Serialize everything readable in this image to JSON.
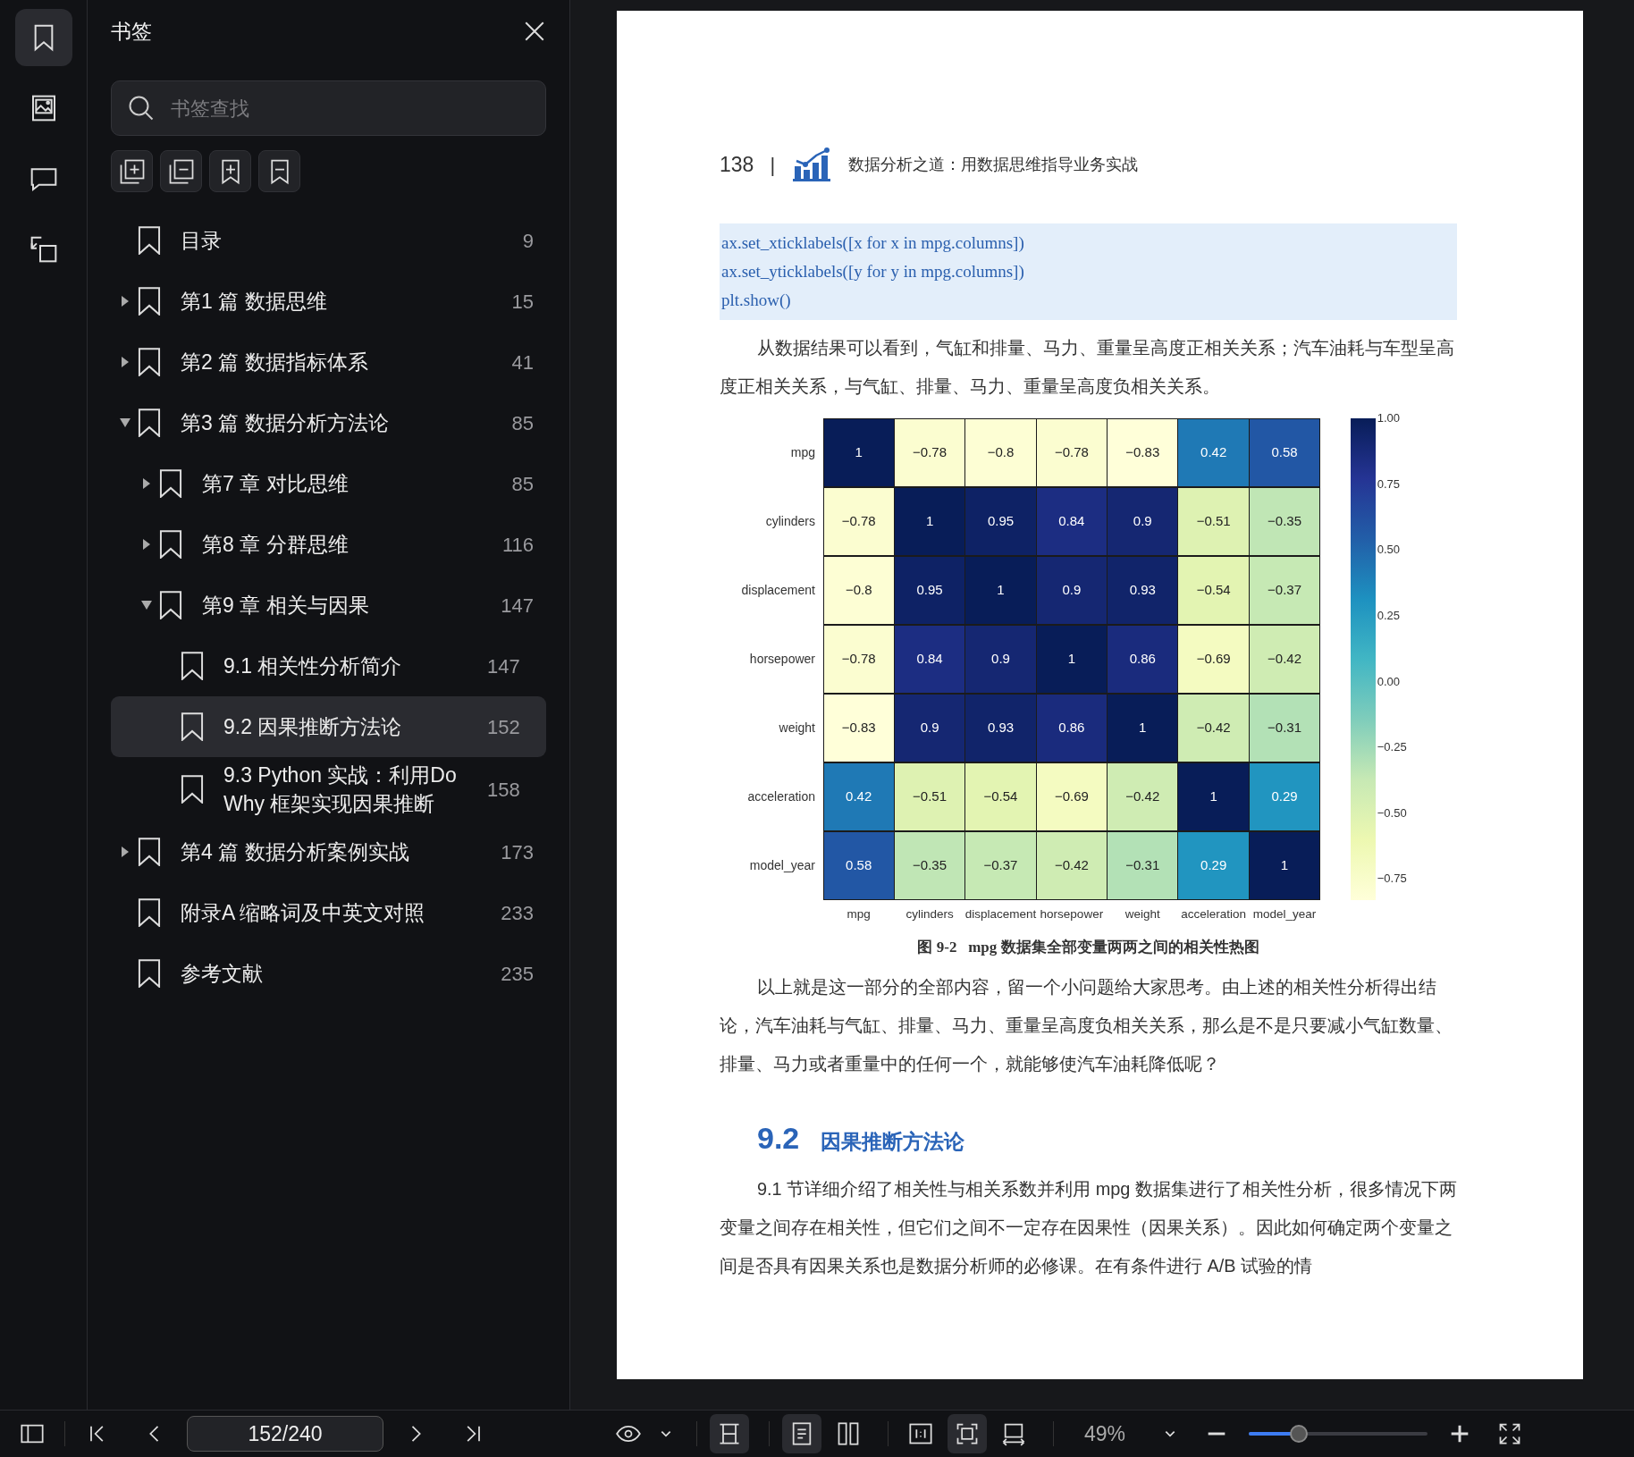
{
  "rail": [
    {
      "kind": "bookmarks",
      "selected": true
    },
    {
      "kind": "images",
      "selected": false
    },
    {
      "kind": "comments",
      "selected": false
    },
    {
      "kind": "export",
      "selected": false
    }
  ],
  "panel": {
    "title": "书签",
    "search": {
      "placeholder": "书签查找"
    }
  },
  "bookmarks": [
    {
      "label": "目录",
      "page": "9",
      "selected": false
    },
    {
      "label": "第1 篇 数据思维",
      "page": "15",
      "expanded": false,
      "selected": false
    },
    {
      "label": "第2 篇 数据指标体系",
      "page": "41",
      "expanded": false,
      "selected": false
    },
    {
      "label": "第3 篇 数据分析方法论",
      "page": "85",
      "expanded": true,
      "selected": false,
      "children": [
        {
          "label": "第7 章 对比思维",
          "page": "85",
          "expanded": false,
          "selected": false
        },
        {
          "label": "第8 章 分群思维",
          "page": "116",
          "expanded": false,
          "selected": false
        },
        {
          "label": "第9 章 相关与因果",
          "page": "147",
          "expanded": true,
          "selected": false,
          "children": [
            {
              "label": "9.1 相关性分析简介",
              "page": "147",
              "selected": false
            },
            {
              "label": "9.2 因果推断方法论",
              "page": "152",
              "selected": true
            },
            {
              "label": "9.3 Python 实战：利用Do Why 框架实现因果推断",
              "page": "158",
              "selected": false
            }
          ]
        }
      ]
    },
    {
      "label": "第4 篇 数据分析案例实战",
      "page": "173",
      "expanded": false,
      "selected": false
    },
    {
      "label": "附录A 缩略词及中英文对照",
      "page": "233",
      "selected": false
    },
    {
      "label": "参考文献",
      "page": "235",
      "selected": false
    }
  ],
  "document": {
    "header": {
      "page_number": "138",
      "separator": "|",
      "book_title": "数据分析之道：用数据思维指导业务实战"
    },
    "blocks": [
      {
        "kind": "code",
        "lines": [
          "ax.set_xticklabels([x for x in mpg.columns])",
          "ax.set_yticklabels([y for y in mpg.columns])",
          "plt.show()"
        ]
      },
      {
        "kind": "paragraph",
        "text": "从数据结果可以看到，气缸和排量、马力、重量呈高度正相关关系；汽车油耗与车型呈高度正相关关系，与气缸、排量、马力、重量呈高度负相关关系。"
      },
      {
        "kind": "heatmap",
        "row_labels": [
          "mpg",
          "cylinders",
          "displacement",
          "horsepower",
          "weight",
          "acceleration",
          "model_year"
        ],
        "column_labels": [
          "mpg",
          "cylinders",
          "displacement",
          "horsepower",
          "weight",
          "acceleration",
          "model_year"
        ],
        "rows": [
          [
            "1",
            "−0.78",
            "−0.8",
            "−0.78",
            "−0.83",
            "0.42",
            "0.58"
          ],
          [
            "−0.78",
            "1",
            "0.95",
            "0.84",
            "0.9",
            "−0.51",
            "−0.35"
          ],
          [
            "−0.8",
            "0.95",
            "1",
            "0.9",
            "0.93",
            "−0.54",
            "−0.37"
          ],
          [
            "−0.78",
            "0.84",
            "0.9",
            "1",
            "0.86",
            "−0.69",
            "−0.42"
          ],
          [
            "−0.83",
            "0.9",
            "0.93",
            "0.86",
            "1",
            "−0.42",
            "−0.31"
          ],
          [
            "0.42",
            "−0.51",
            "−0.54",
            "−0.69",
            "−0.42",
            "1",
            "0.29"
          ],
          [
            "0.58",
            "−0.35",
            "−0.37",
            "−0.42",
            "−0.31",
            "0.29",
            "1"
          ]
        ],
        "colorbar_ticks": [
          "1.00",
          "0.75",
          "0.50",
          "0.25",
          "0.00",
          "−0.25",
          "−0.50",
          "−0.75"
        ]
      },
      {
        "kind": "caption",
        "text": "图 9-2   mpg 数据集全部变量两两之间的相关性热图"
      },
      {
        "kind": "paragraph",
        "text": "以上就是这一部分的全部内容，留一个小问题给大家思考。由上述的相关性分析得出结论，汽车油耗与气缸、排量、马力、重量呈高度负相关关系，那么是不是只要减小气缸数量、排量、马力或者重量中的任何一个，就能够使汽车油耗降低呢？"
      },
      {
        "kind": "heading",
        "number": "9.2",
        "text": "因果推断方法论"
      },
      {
        "kind": "paragraph",
        "text": "9.1 节详细介绍了相关性与相关系数并利用 mpg 数据集进行了相关性分析，很多情况下两变量之间存在相关性，但它们之间不一定存在因果性（因果关系）。因此如何确定两个变量之间是否具有因果关系也是数据分析师的必修课。在有条件进行 A/B 试验的情"
      }
    ]
  },
  "toolbar": {
    "page_field": "152/240",
    "view_groups": [
      [
        {
          "kind": "fit-height",
          "selected": true
        }
      ],
      [
        {
          "kind": "single-page",
          "selected": true
        },
        {
          "kind": "two-page",
          "selected": false
        }
      ],
      [
        {
          "kind": "actual-size",
          "selected": false
        },
        {
          "kind": "fit-page",
          "selected": true
        },
        {
          "kind": "fit-width",
          "selected": false
        }
      ]
    ],
    "zoom": "49%",
    "zoom_slider": {
      "level": 0.28
    }
  }
}
